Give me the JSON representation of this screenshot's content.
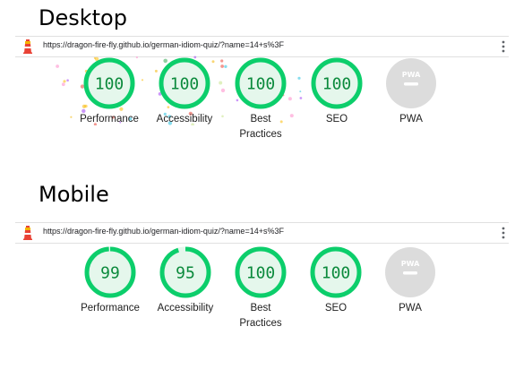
{
  "desktop": {
    "section_title": "Desktop",
    "url": "https://dragon-fire-fly.github.io/german-idiom-quiz/?name=14+s%3F",
    "gauges": [
      {
        "label": "Performance",
        "score": "100",
        "value": 100
      },
      {
        "label": "Accessibility",
        "score": "100",
        "value": 100
      },
      {
        "label": "Best Practices",
        "score": "100",
        "value": 100
      },
      {
        "label": "SEO",
        "score": "100",
        "value": 100
      },
      {
        "label": "PWA",
        "badge": "PWA"
      }
    ]
  },
  "mobile": {
    "section_title": "Mobile",
    "url": "https://dragon-fire-fly.github.io/german-idiom-quiz/?name=14+s%3F",
    "gauges": [
      {
        "label": "Performance",
        "score": "99",
        "value": 99
      },
      {
        "label": "Accessibility",
        "score": "95",
        "value": 95
      },
      {
        "label": "Best Practices",
        "score": "100",
        "value": 100
      },
      {
        "label": "SEO",
        "score": "100",
        "value": 100
      },
      {
        "label": "PWA",
        "badge": "PWA"
      }
    ]
  },
  "icons": {
    "logo": "lighthouse-logo-icon",
    "menu": "more-vert-icon"
  },
  "colors": {
    "pass_ring": "#0cce6b",
    "pass_fill": "#e5f7ec",
    "pass_text": "#0b8a3c",
    "pwa_gray": "#dcdcdc"
  }
}
